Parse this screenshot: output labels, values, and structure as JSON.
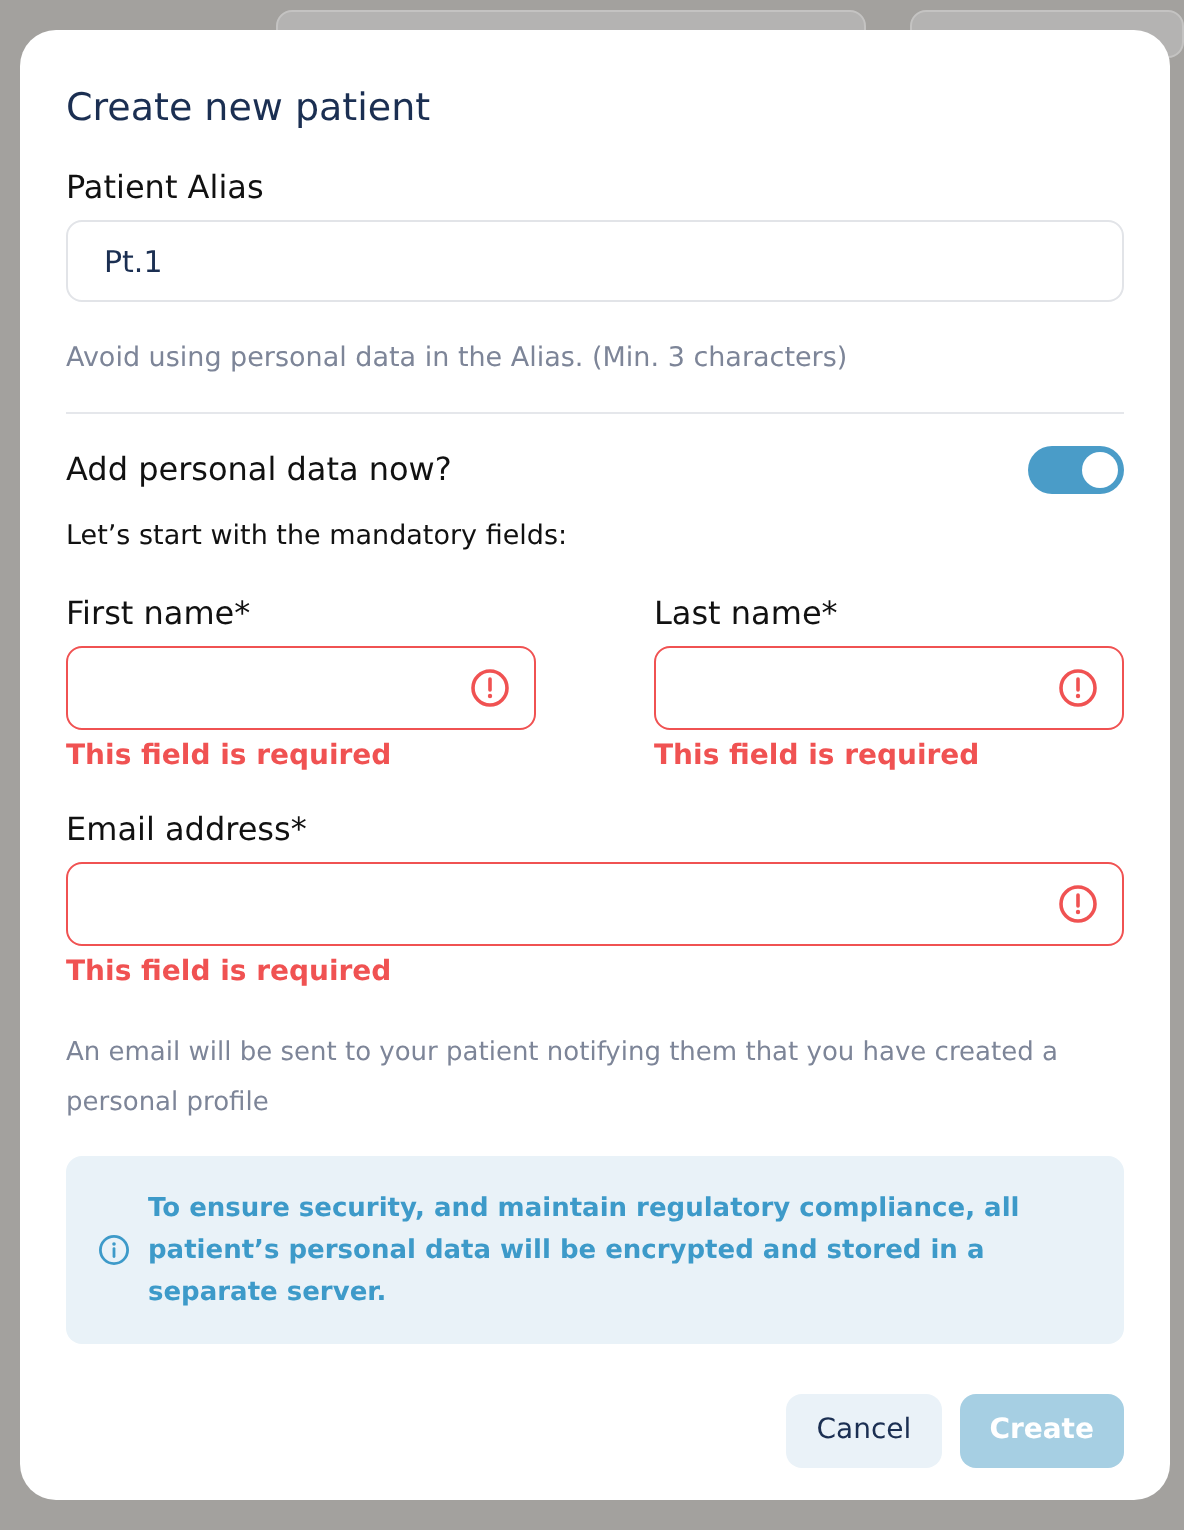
{
  "dialog": {
    "title": "Create new patient",
    "alias": {
      "label": "Patient Alias",
      "value": "Pt.1",
      "hint": "Avoid using personal data in the Alias. (Min. 3 characters)"
    },
    "personal_data": {
      "label": "Add personal data now?",
      "on": true
    },
    "mandatory_note": "Let’s start with the mandatory fields:",
    "name_fields": [
      {
        "label": "First name*",
        "invalid": true,
        "error": "This field is required"
      },
      {
        "label": "Last name*",
        "invalid": true,
        "error": "This field is required"
      }
    ],
    "email_field": {
      "label": "Email address*",
      "invalid": true,
      "error": "This field is required"
    },
    "email_note": "An email will be sent to your patient notifying them that you have created a personal profile",
    "info": "To ensure security, and maintain regulatory compliance, all patient’s personal data will be encrypted and stored in a separate server.",
    "buttons": [
      {
        "label": "Cancel",
        "kind": "secondary",
        "disabled": false
      },
      {
        "label": "Create",
        "kind": "primary",
        "disabled": true
      }
    ]
  }
}
